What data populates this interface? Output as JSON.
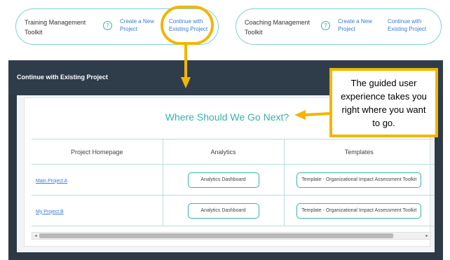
{
  "toolkits": [
    {
      "title": "Training Management Toolkit",
      "help": "?",
      "create_link": "Create a New Project",
      "continue_link": "Continue with Existing Project"
    },
    {
      "title": "Coaching Management Toolkit",
      "help": "?",
      "create_link": "Create a New Project",
      "continue_link": "Continue with Existing Project"
    }
  ],
  "dialog": {
    "title": "Continue with Existing Project",
    "heading": "Where Should We Go Next?",
    "table": {
      "columns": [
        "Project Homepage",
        "Analytics",
        "Templates"
      ],
      "rows": [
        {
          "project": "Main Project A",
          "analytics": "Analytics Dashboard",
          "template": "Template - Organizational Impact Assessment Toolkit"
        },
        {
          "project": "My Project B",
          "analytics": "Analytics Dashboard",
          "template": "Template - Organizational Impact Assessment Toolkit"
        }
      ]
    },
    "scrollbar": {
      "left_arrow": "◂",
      "right_arrow": "▸"
    }
  },
  "callout": {
    "text": "The guided user experience takes you right where you want to go."
  },
  "colors": {
    "highlight": "#f2b600",
    "teal": "#37b3a9",
    "link": "#3a7bd5",
    "dialog_bg": "#2d3a46"
  }
}
